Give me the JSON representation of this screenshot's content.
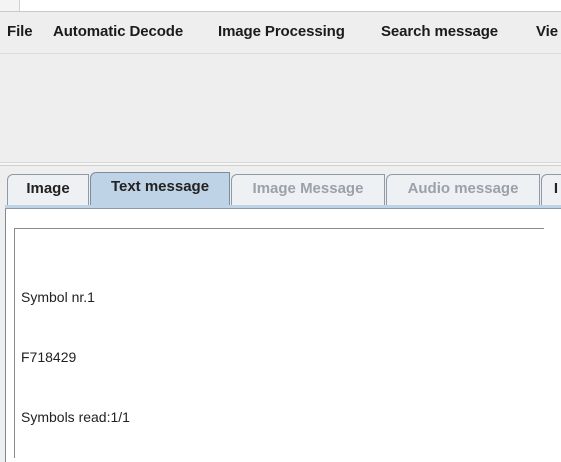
{
  "menubar": {
    "items": [
      {
        "label": "File"
      },
      {
        "label": "Automatic Decode"
      },
      {
        "label": "Image Processing"
      },
      {
        "label": "Search message"
      },
      {
        "label": "Vie"
      }
    ]
  },
  "tabs": [
    {
      "label": "Image",
      "state": "normal"
    },
    {
      "label": "Text message",
      "state": "selected"
    },
    {
      "label": "Image Message",
      "state": "disabled"
    },
    {
      "label": "Audio message",
      "state": "disabled"
    },
    {
      "label": "I",
      "state": "normal"
    }
  ],
  "text_message": {
    "lines": [
      "Symbol nr.1",
      "F718429",
      "Symbols read:1/1"
    ]
  },
  "colors": {
    "selected_tab": "#bfd3e6",
    "disabled_tab_text": "#9aa1aa",
    "window_bg": "#eeeeee"
  }
}
